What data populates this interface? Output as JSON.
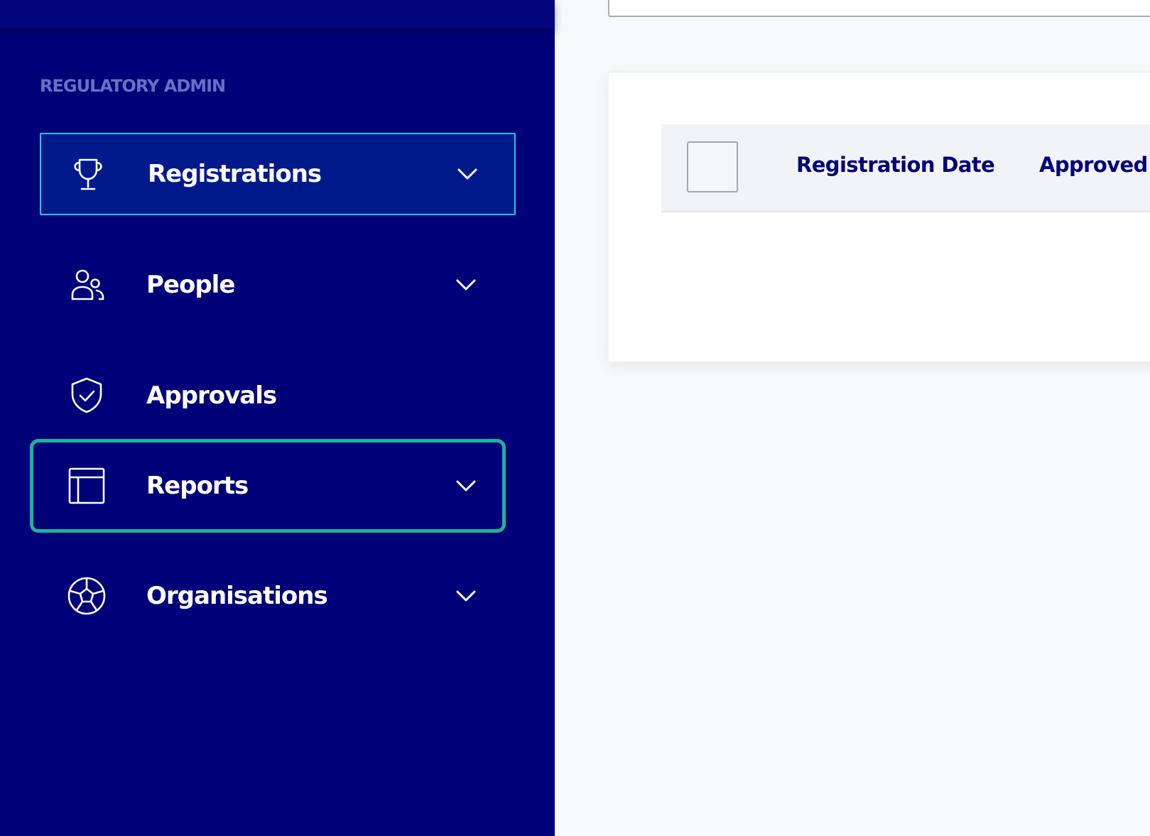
{
  "sidebar": {
    "section_label": "REGULATORY ADMIN",
    "items": [
      {
        "label": "Registrations",
        "icon": "trophy-icon",
        "has_chevron": true,
        "state": "active"
      },
      {
        "label": "People",
        "icon": "people-icon",
        "has_chevron": true,
        "state": "normal"
      },
      {
        "label": "Approvals",
        "icon": "shield-check-icon",
        "has_chevron": false,
        "state": "normal"
      },
      {
        "label": "Reports",
        "icon": "table-layout-icon",
        "has_chevron": true,
        "state": "focused"
      },
      {
        "label": "Organisations",
        "icon": "soccer-ball-icon",
        "has_chevron": true,
        "state": "normal"
      }
    ]
  },
  "table": {
    "columns": [
      "Registration Date",
      "Approved"
    ]
  },
  "colors": {
    "sidebar_bg": "#000078",
    "active_item_bg": "#001a8c",
    "active_item_border": "#1cc8ee",
    "focus_ring": "#1fb39a",
    "section_label": "#6a6fc4",
    "header_text": "#000078"
  }
}
